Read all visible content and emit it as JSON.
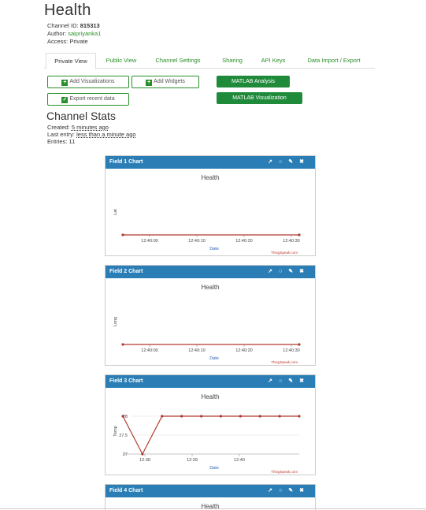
{
  "channel": {
    "title": "Health",
    "id_label": "Channel ID: ",
    "id_value": "815313",
    "author_label": "Author: ",
    "author_value": "saipriyanka1",
    "access_label": "Access: ",
    "access_value": "Private"
  },
  "tabs": [
    {
      "label": "Private View",
      "active": true
    },
    {
      "label": "Public View",
      "active": false
    },
    {
      "label": "Channel Settings",
      "active": false
    },
    {
      "label": "Sharing",
      "active": false
    },
    {
      "label": "API Keys",
      "active": false
    },
    {
      "label": "Data Import / Export",
      "active": false
    }
  ],
  "actions": {
    "add_visualizations": "Add Visualizations",
    "add_widgets": "Add Widgets",
    "export_recent": "Export recent data",
    "matlab_analysis": "MATLAB Analysis",
    "matlab_visualization": "MATLAB Visualization"
  },
  "stats": {
    "heading": "Channel Stats",
    "created_label": "Created: ",
    "created_value": "5 minutes ago",
    "last_entry_label": "Last entry: ",
    "last_entry_value": "less than a minute ago",
    "entries_label": "Entries: ",
    "entries_value": "11"
  },
  "colors": {
    "accent_green": "#2a8f2a",
    "matlab_green": "#1f8a3a",
    "chart_header_blue": "#2a7db5",
    "series_red": "#b03a2e"
  },
  "icons": [
    "external-link-icon",
    "comment-icon",
    "pencil-icon",
    "close-icon"
  ],
  "chart_data": [
    {
      "type": "line",
      "header": "Field 1 Chart",
      "title": "Health",
      "xlabel": "Date",
      "ylabel": "Lat",
      "x_ticks": [
        "12:40:00",
        "12:40:10",
        "12:40:20",
        "12:40:30"
      ],
      "y_ticks": [],
      "ylim": [
        0,
        1
      ],
      "series": [
        {
          "values": [
            0,
            0
          ]
        }
      ],
      "credit": "ThingSpeak.com"
    },
    {
      "type": "line",
      "header": "Field 2 Chart",
      "title": "Health",
      "xlabel": "Date",
      "ylabel": "Long",
      "x_ticks": [
        "12:40:00",
        "12:40:10",
        "12:40:20",
        "12:40:30"
      ],
      "y_ticks": [],
      "ylim": [
        0,
        1
      ],
      "series": [
        {
          "values": [
            0,
            0
          ]
        }
      ],
      "credit": "ThingSpeak.com"
    },
    {
      "type": "line",
      "header": "Field 3 Chart",
      "title": "Health",
      "xlabel": "Date",
      "ylabel": "Temp",
      "x_ticks": [
        "12:38",
        "12:39",
        "12:40"
      ],
      "y_ticks": [
        "27",
        "27.5",
        "28"
      ],
      "ylim": [
        27,
        28
      ],
      "series": [
        {
          "values": [
            28,
            27,
            28,
            28,
            28,
            28,
            28,
            28,
            28,
            28
          ]
        }
      ],
      "credit": "ThingSpeak.com"
    },
    {
      "type": "line",
      "header": "Field 4 Chart",
      "title": "Health"
    }
  ]
}
